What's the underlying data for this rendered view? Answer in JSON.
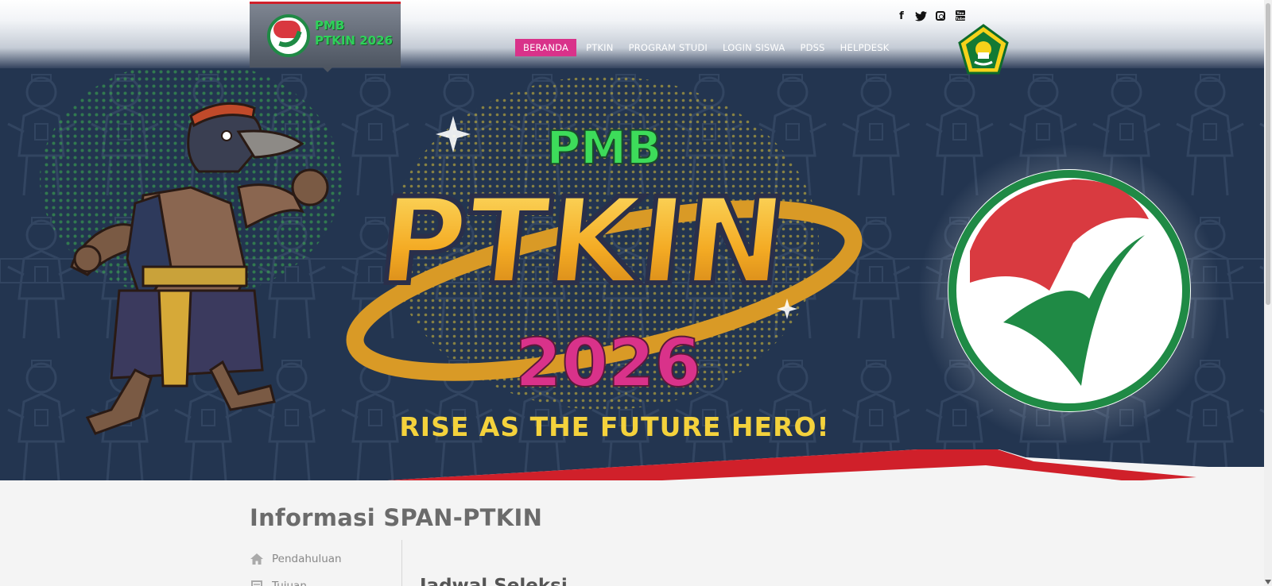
{
  "logo": {
    "line1": "PMB",
    "line2": "PTKIN 2026"
  },
  "social": {
    "facebook": "facebook-icon",
    "twitter": "twitter-icon",
    "instagram": "instagram-icon",
    "youtube": "youtube-icon",
    "facebook_glyph": "f",
    "youtube_glyph": "You\nTube"
  },
  "nav": {
    "items": [
      "BERANDA",
      "PTKIN",
      "PROGRAM STUDI",
      "LOGIN SISWA",
      "PDSS",
      "HELPDESK"
    ],
    "active_index": 0,
    "active_color": "#d9328a"
  },
  "hero": {
    "pmb": "PMB",
    "ptkin": "PTKIN",
    "year": "2026",
    "tagline": "RISE AS THE FUTURE HERO!",
    "colors": {
      "background": "#233550",
      "pmb": "#3ddc5a",
      "ptkin": "#f4b52c",
      "year": "#d9328a",
      "tagline": "#f4d23c",
      "stripe": "#d0202a"
    }
  },
  "content": {
    "title": "Informasi SPAN-PTKIN",
    "side_menu": [
      {
        "icon": "home-icon",
        "label": "Pendahuluan"
      },
      {
        "icon": "document-icon",
        "label": "Tujuan"
      }
    ],
    "section_heading": "Jadwal Seleksi"
  }
}
